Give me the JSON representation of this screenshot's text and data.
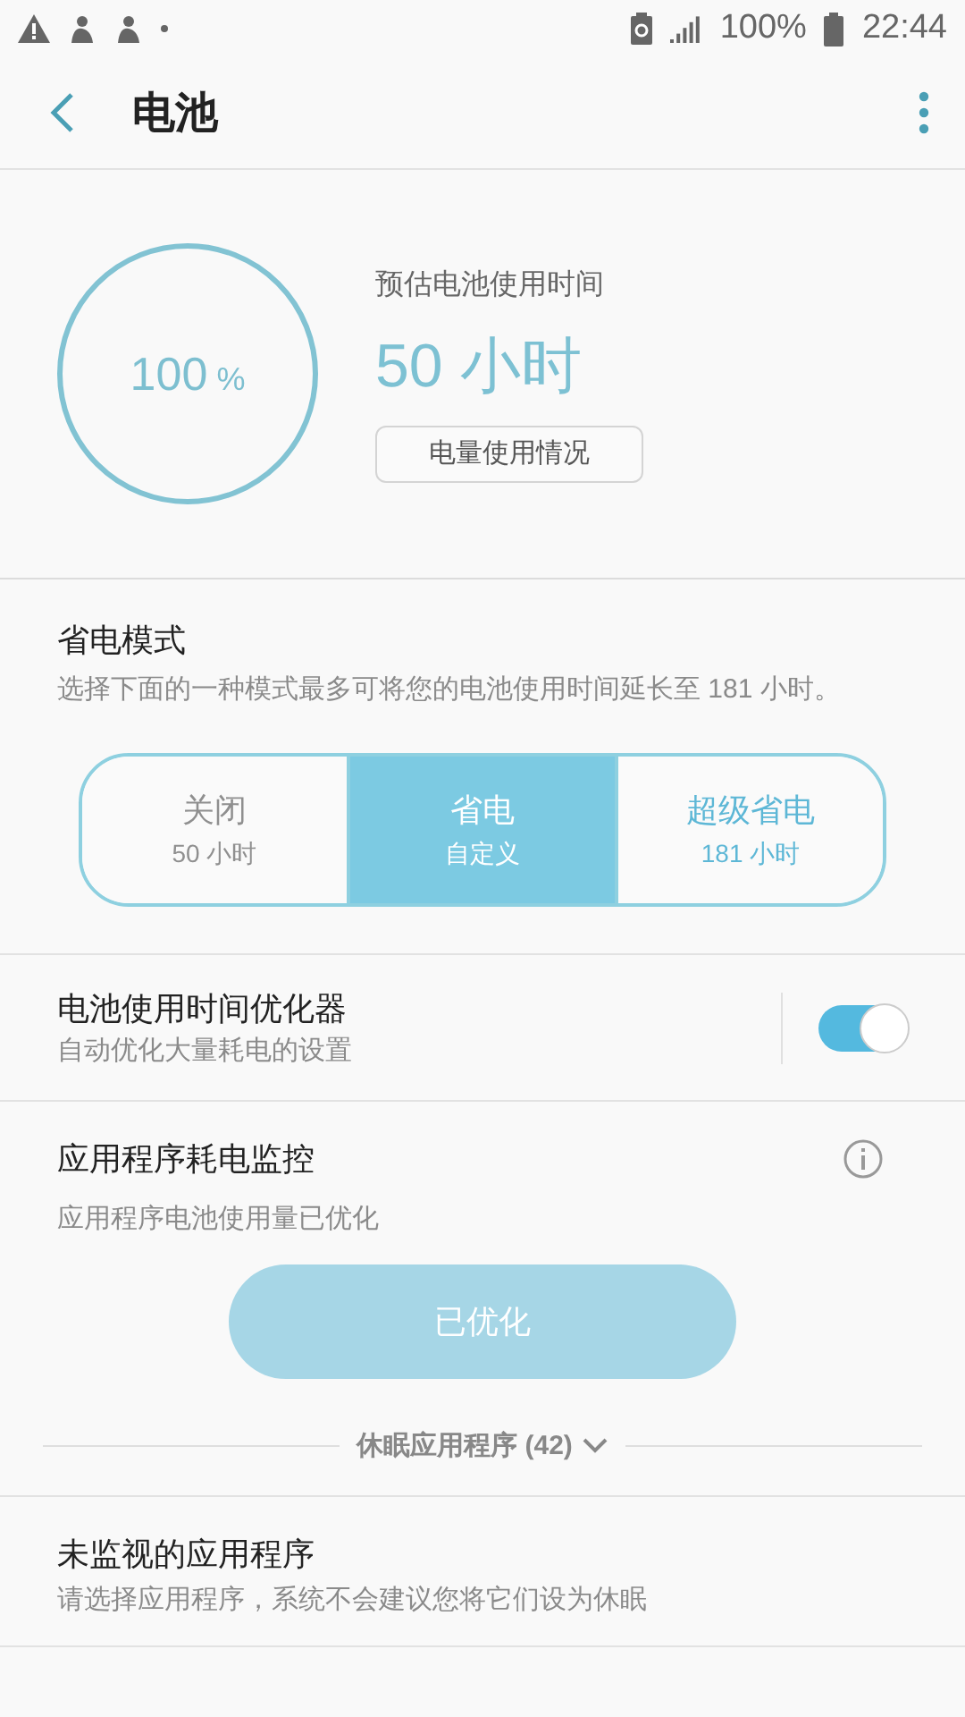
{
  "status_bar": {
    "battery": "100%",
    "time": "22:44"
  },
  "header": {
    "title": "电池"
  },
  "battery": {
    "percent": "100",
    "percent_sign": "%",
    "estimate_label": "预估电池使用时间",
    "estimate": "50 小时",
    "usage_button": "电量使用情况"
  },
  "power_mode": {
    "title": "省电模式",
    "description": "选择下面的一种模式最多可将您的电池使用时间延长至 181 小时。",
    "options": [
      {
        "label": "关闭",
        "sublabel": "50 小时",
        "selected": false,
        "kind": "normal"
      },
      {
        "label": "省电",
        "sublabel": "自定义",
        "selected": true,
        "kind": "normal"
      },
      {
        "label": "超级省电",
        "sublabel": "181 小时",
        "selected": false,
        "kind": "emphasis"
      }
    ]
  },
  "optimizer": {
    "title": "电池使用时间优化器",
    "subtitle": "自动优化大量耗电的设置",
    "on": true
  },
  "app_monitor": {
    "title": "应用程序耗电监控",
    "subtitle": "应用程序电池使用量已优化",
    "button": {
      "label": "已优化",
      "disabled": true
    },
    "sleeping_apps": {
      "label": "休眠应用程序 (42)",
      "expanded": false
    }
  },
  "unmonitored": {
    "title": "未监视的应用程序",
    "subtitle": "请选择应用程序，系统不会建议您将它们设为休眠"
  }
}
